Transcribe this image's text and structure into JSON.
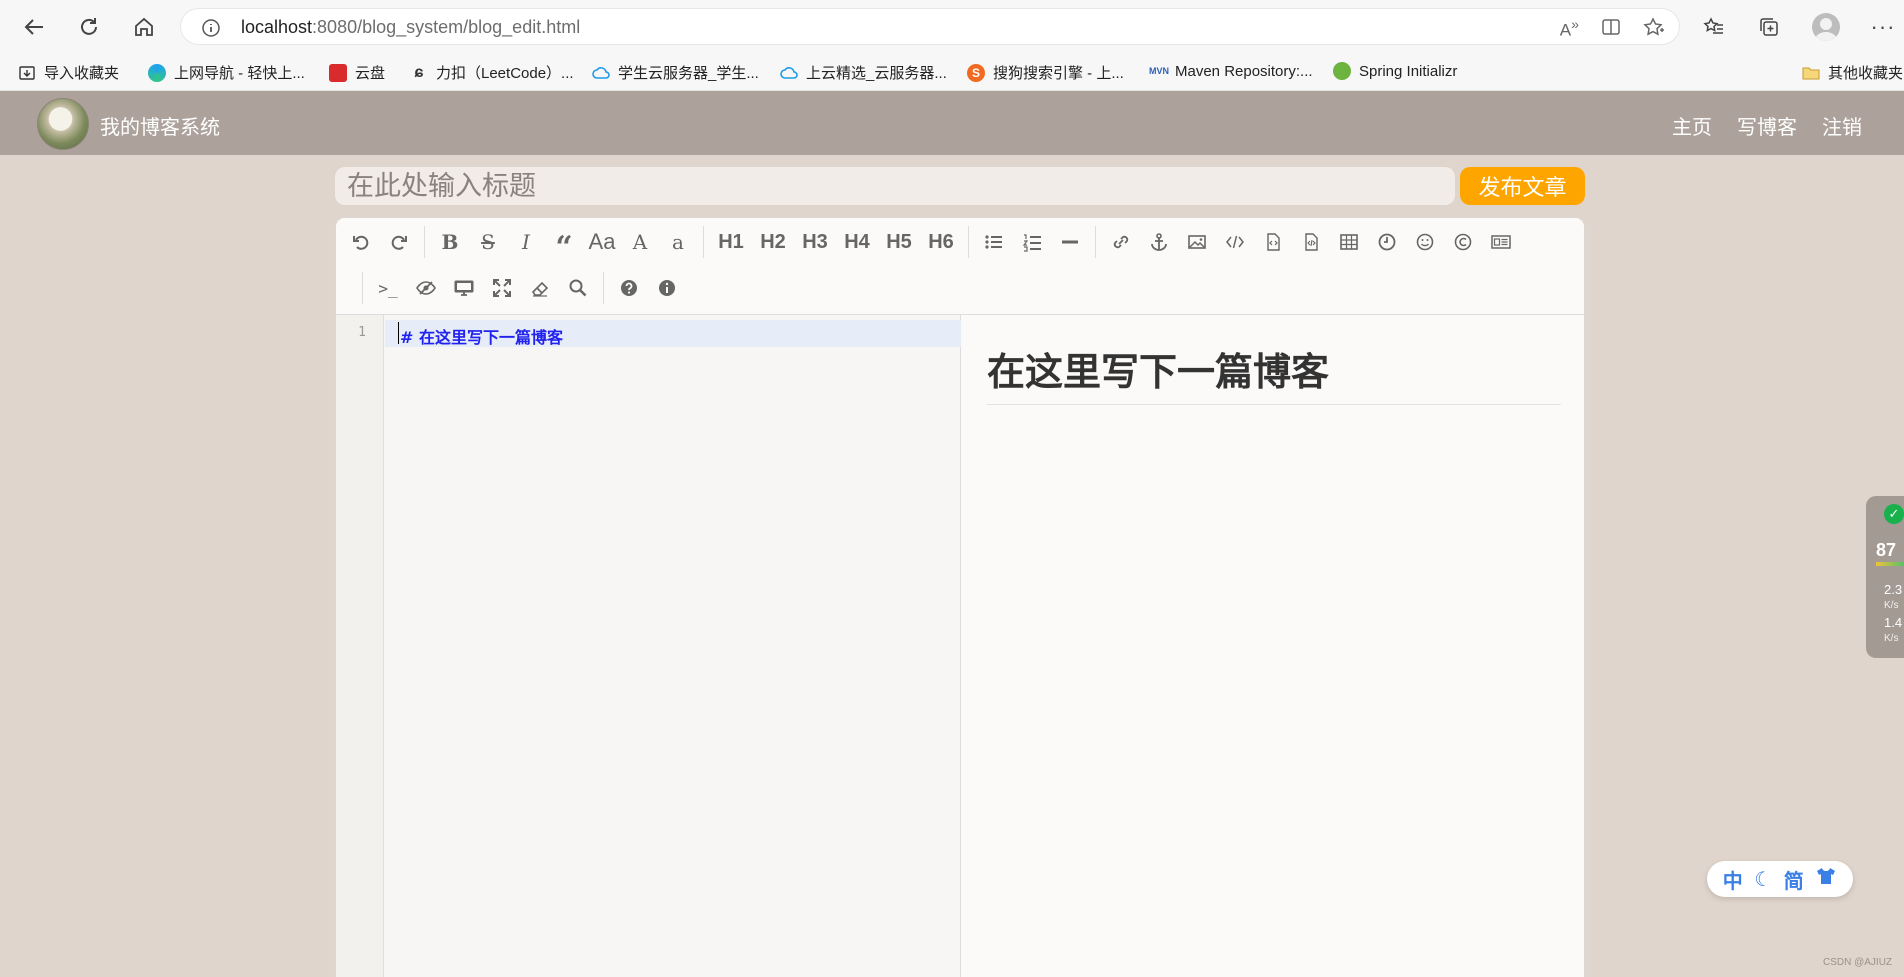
{
  "browser": {
    "url_host": "localhost",
    "url_rest": ":8080/blog_system/blog_edit.html",
    "bookmarks": [
      {
        "label": "导入收藏夹",
        "icon": "import-icon"
      },
      {
        "label": "上网导航 - 轻快上...",
        "icon": "edge-icon"
      },
      {
        "label": "云盘",
        "icon": "cloud-drive-icon"
      },
      {
        "label": "力扣（LeetCode）...",
        "icon": "leetcode-icon"
      },
      {
        "label": "学生云服务器_学生...",
        "icon": "cloud-icon"
      },
      {
        "label": "上云精选_云服务器...",
        "icon": "cloud-icon"
      },
      {
        "label": "搜狗搜索引擎 - 上...",
        "icon": "sogou-icon"
      },
      {
        "label": "Maven Repository:...",
        "icon": "maven-icon"
      },
      {
        "label": "Spring Initializr",
        "icon": "spring-icon"
      }
    ],
    "other_bookmarks": "其他收藏夹"
  },
  "nav": {
    "site_title": "我的博客系统",
    "links": [
      "主页",
      "写博客",
      "注销"
    ]
  },
  "editor": {
    "title_placeholder": "在此处输入标题",
    "publish_label": "发布文章",
    "headings": [
      "H1",
      "H2",
      "H3",
      "H4",
      "H5",
      "H6"
    ],
    "line_number": "1",
    "markdown_line": "# 在这里写下一篇博客",
    "preview_heading": "在这里写下一篇博客"
  },
  "widget": {
    "score": "87",
    "up_speed": "2.3",
    "up_unit": "K/s",
    "down_speed": "1.4",
    "down_unit": "K/s"
  },
  "ime": {
    "lang": "中",
    "script": "简"
  },
  "watermark": "CSDN @AJIUZ",
  "colors": {
    "nav_bg": "#aca29b",
    "page_bg": "#e0d5cc",
    "publish_bg": "#ffa500",
    "code_heading": "#2222ee"
  }
}
